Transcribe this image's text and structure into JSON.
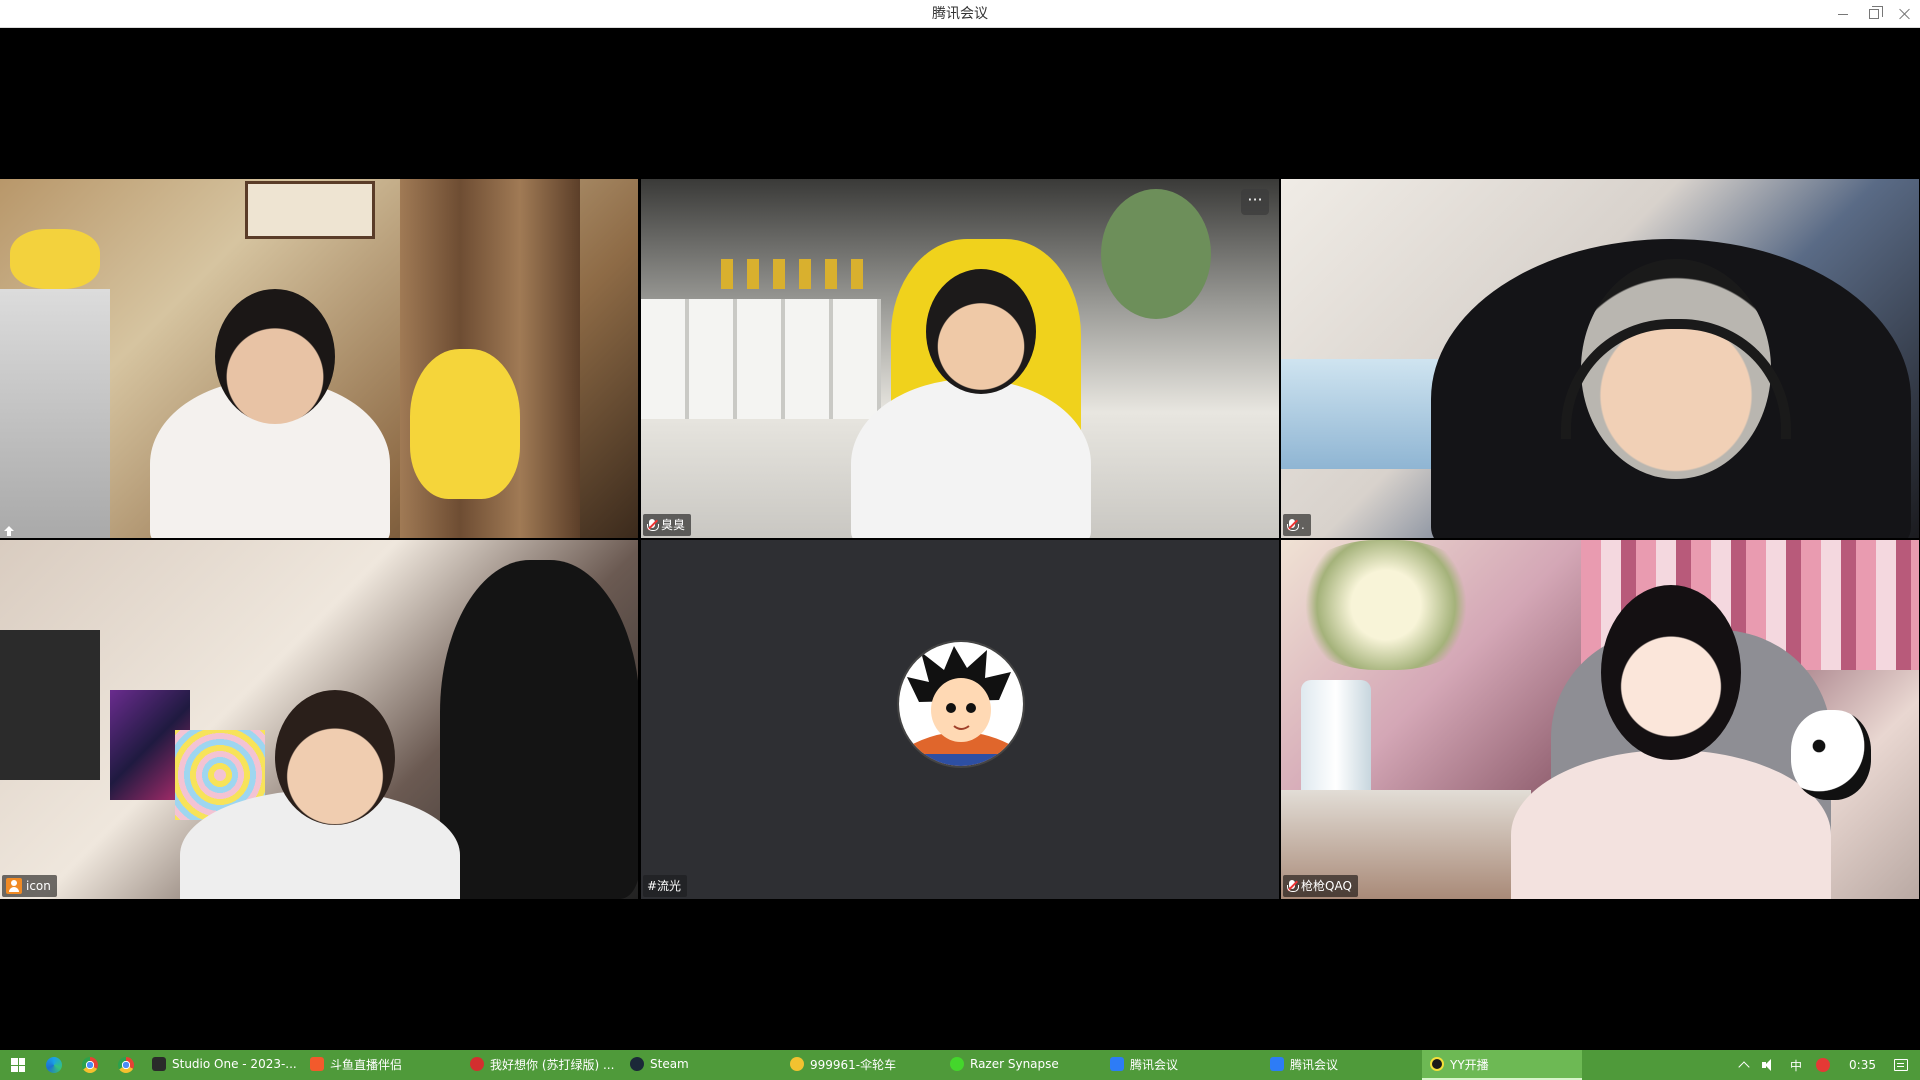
{
  "window": {
    "title": "腾讯会议"
  },
  "participants": [
    {
      "name": "",
      "indicator": "share"
    },
    {
      "name": "臭臭",
      "indicator": "mic-muted",
      "has_more_menu": true
    },
    {
      "name": ".",
      "indicator": "mic-muted"
    },
    {
      "name": "icon",
      "indicator": "person"
    },
    {
      "name": "#流光",
      "indicator": "none",
      "video_off": true,
      "avatar": "anime-avatar"
    },
    {
      "name": "枪枪QAQ",
      "indicator": "mic-muted"
    }
  ],
  "more_button": {
    "label": "···"
  },
  "taskbar": {
    "pinned": [
      "edge-icon",
      "chrome-icon",
      "chrome-icon"
    ],
    "apps": [
      {
        "label": "Studio One - 2023-...",
        "icon": "studio-one-icon",
        "color": "#2a2a2a",
        "active": false
      },
      {
        "label": "斗鱼直播伴侣",
        "icon": "douyu-icon",
        "color": "#f25a2c",
        "active": false
      },
      {
        "label": "我好想你 (苏打绿版) ...",
        "icon": "netease-music-icon",
        "color": "#d32f2f",
        "active": false
      },
      {
        "label": "Steam",
        "icon": "steam-icon",
        "color": "#1b2838",
        "active": false
      },
      {
        "label": "999961-伞轮车",
        "icon": "face-icon",
        "color": "#f2c230",
        "active": false
      },
      {
        "label": "Razer Synapse",
        "icon": "razer-icon",
        "color": "#44d62c",
        "active": false
      },
      {
        "label": "腾讯会议",
        "icon": "tencent-meeting-icon",
        "color": "#2d7cf6",
        "active": false
      },
      {
        "label": "腾讯会议",
        "icon": "tencent-meeting-icon",
        "color": "#2d7cf6",
        "active": false
      },
      {
        "label": "YY开播",
        "icon": "yy-icon",
        "color": "#1a1a1a",
        "active": true
      }
    ],
    "tray": {
      "ime": "中",
      "time": "0:35"
    }
  },
  "colors": {
    "taskbar": "#4f9a3a",
    "taskbar_active": "#6db954",
    "meeting_bg": "#000000",
    "empty_tile": "#2e2f33"
  }
}
